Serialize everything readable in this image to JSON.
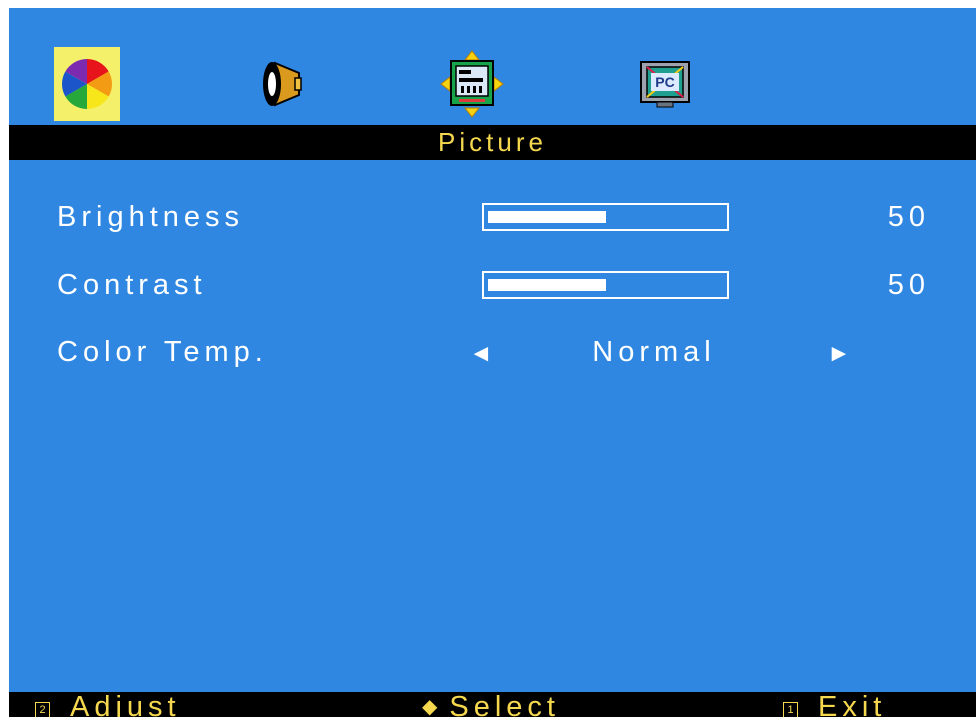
{
  "tabs": [
    {
      "name": "picture",
      "icon": "color-wheel-icon",
      "active": true
    },
    {
      "name": "audio",
      "icon": "speaker-icon",
      "active": false
    },
    {
      "name": "image-setup",
      "icon": "display-adjust-icon",
      "active": false
    },
    {
      "name": "pc",
      "icon": "pc-monitor-icon",
      "active": false
    }
  ],
  "title": "Picture",
  "settings": {
    "brightness": {
      "label": "Brightness",
      "value": "50",
      "level": 50
    },
    "contrast": {
      "label": "Contrast",
      "value": "50",
      "level": 50
    },
    "color_temp": {
      "label": "Color Temp.",
      "value": "Normal",
      "left_arrow": "◄",
      "right_arrow": "►"
    }
  },
  "footer": {
    "adjust": {
      "key": "2",
      "label": "Adjust"
    },
    "select": {
      "symbol": "◆",
      "label": "Select"
    },
    "exit": {
      "key": "1",
      "label": "Exit"
    }
  },
  "colors": {
    "background": "#2f87e2",
    "title_text": "#f6d84e",
    "active_tab": "#f4f06a"
  }
}
